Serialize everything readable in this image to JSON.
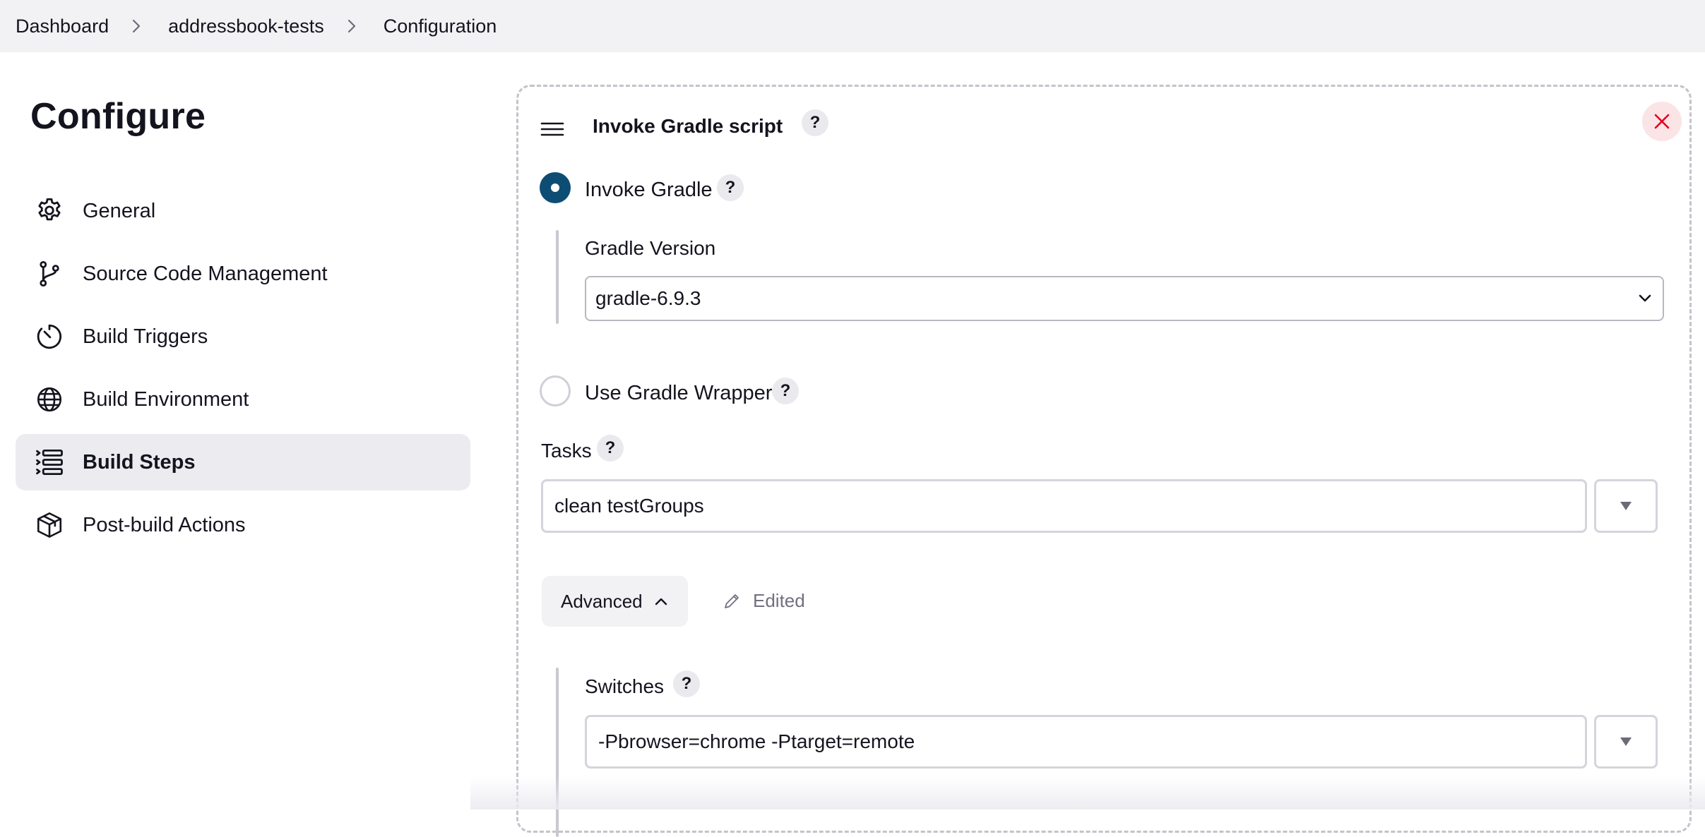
{
  "breadcrumb": {
    "items": [
      "Dashboard",
      "addressbook-tests",
      "Configuration"
    ]
  },
  "page": {
    "title": "Configure"
  },
  "sidebar": {
    "items": [
      {
        "label": "General",
        "icon": "gear-icon"
      },
      {
        "label": "Source Code Management",
        "icon": "git-branch-icon"
      },
      {
        "label": "Build Triggers",
        "icon": "timer-icon"
      },
      {
        "label": "Build Environment",
        "icon": "globe-icon"
      },
      {
        "label": "Build Steps",
        "icon": "list-icon",
        "active": true
      },
      {
        "label": "Post-build Actions",
        "icon": "package-icon"
      }
    ]
  },
  "step": {
    "title": "Invoke Gradle script",
    "help": "?",
    "invoke_gradle": {
      "label": "Invoke Gradle",
      "selected": true,
      "version_label": "Gradle Version",
      "version_value": "gradle-6.9.3"
    },
    "wrapper": {
      "label": "Use Gradle Wrapper",
      "selected": false
    },
    "tasks": {
      "label": "Tasks",
      "value": "clean testGroups"
    },
    "advanced": {
      "label": "Advanced",
      "edited_label": "Edited"
    },
    "switches": {
      "label": "Switches",
      "value": "-Pbrowser=chrome -Ptarget=remote"
    }
  },
  "colors": {
    "accent": "#0d4d73",
    "close_bg": "#fbe4e6",
    "close_icon": "#e6001f",
    "active_nav_bg": "#ebebf0"
  }
}
